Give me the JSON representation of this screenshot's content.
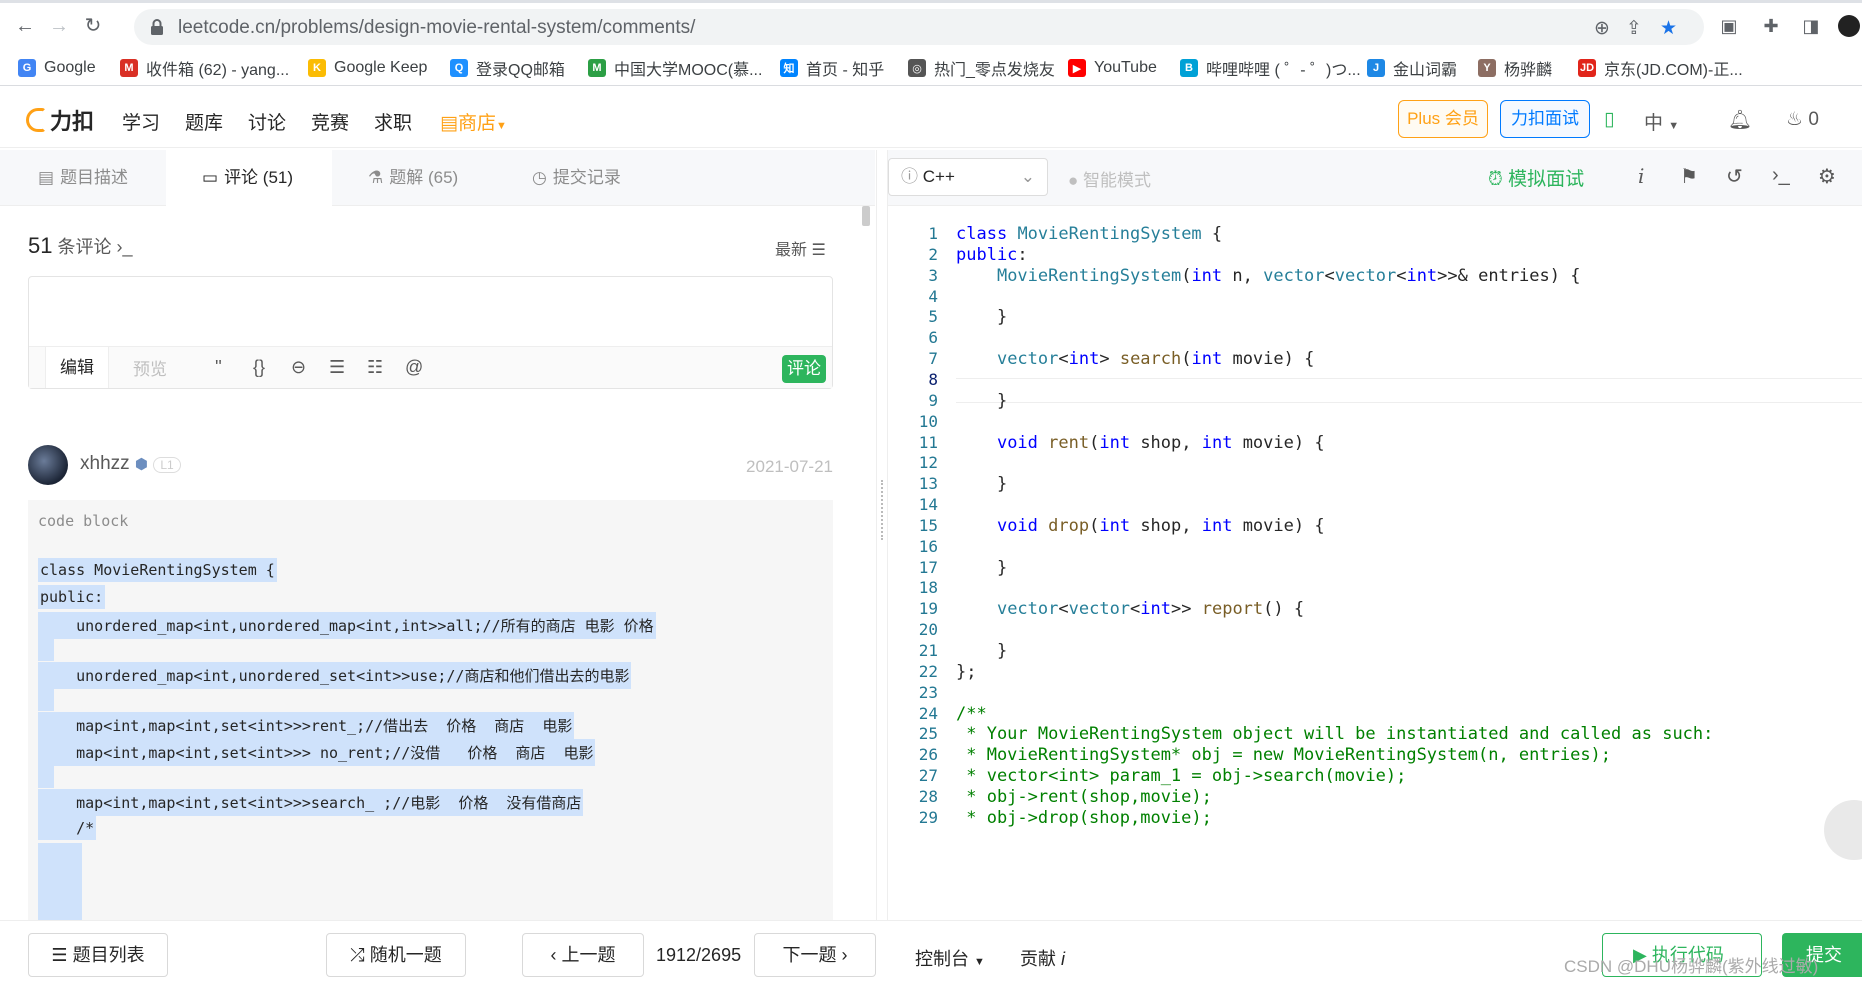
{
  "browser": {
    "url_host": "leetcode.cn",
    "url_path": "/problems/design-movie-rental-system/comments/",
    "bookmarks": [
      {
        "label": "Google",
        "color": "#4285f4",
        "icon": "G"
      },
      {
        "label": "收件箱 (62) - yang...",
        "color": "#d93025",
        "icon": "M"
      },
      {
        "label": "Google Keep",
        "color": "#fbbc04",
        "icon": "K"
      },
      {
        "label": "登录QQ邮箱",
        "color": "#1e90ff",
        "icon": "Q"
      },
      {
        "label": "中国大学MOOC(慕...",
        "color": "#2c9f45",
        "icon": "M"
      },
      {
        "label": "首页 - 知乎",
        "color": "#0084ff",
        "icon": "知"
      },
      {
        "label": "热门_零点发烧友",
        "color": "#555555",
        "icon": "◎"
      },
      {
        "label": "YouTube",
        "color": "#ff0000",
        "icon": "▶"
      },
      {
        "label": "哔哩哔哩 ( ゜- ゜)つ...",
        "color": "#00a1d6",
        "icon": "B"
      },
      {
        "label": "金山词霸",
        "color": "#1e88e5",
        "icon": "J"
      },
      {
        "label": "杨骅麟",
        "color": "#8d6e63",
        "icon": "Y"
      },
      {
        "label": "京东(JD.COM)-正...",
        "color": "#e1251b",
        "icon": "JD"
      }
    ]
  },
  "site": {
    "logo": "力扣",
    "nav": [
      "学习",
      "题库",
      "讨论",
      "竞赛",
      "求职",
      "商店"
    ],
    "plus": "Plus 会员",
    "mock_interview": "力扣面试",
    "lang_switch": "中",
    "points": "0"
  },
  "left": {
    "tabs": [
      "题目描述",
      "评论 (51)",
      "题解 (65)",
      "提交记录"
    ],
    "comment_count": "51",
    "comment_label": "条评论",
    "sort": "最新",
    "editor_tabs": [
      "编辑",
      "预览"
    ],
    "post": "评论",
    "comment": {
      "user": "xhhzz",
      "level": "L1",
      "date": "2021-07-21",
      "code_label": "code block",
      "code_lines": [
        "class MovieRentingSystem {",
        "public:",
        "    unordered_map<int,unordered_map<int,int>>all;//所有的商店 电影 价格",
        "",
        "    unordered_map<int,unordered_set<int>>use;//商店和他们借出去的电影",
        "",
        "    map<int,map<int,set<int>>>rent_;//借出去  价格  商店  电影",
        "    map<int,map<int,set<int>>> no_rent;//没借   价格  商店  电影",
        "",
        "    map<int,map<int,set<int>>>search_ ;//电影  价格  没有借商店",
        "    /*"
      ]
    }
  },
  "right": {
    "language": "C++",
    "smart_mode": "智能模式",
    "mock": "模拟面试",
    "code_lines": [
      "class MovieRentingSystem {",
      "public:",
      "    MovieRentingSystem(int n, vector<vector<int>>& entries) {",
      "",
      "    }",
      "",
      "    vector<int> search(int movie) {",
      "",
      "    }",
      "",
      "    void rent(int shop, int movie) {",
      "",
      "    }",
      "",
      "    void drop(int shop, int movie) {",
      "",
      "    }",
      "",
      "    vector<vector<int>> report() {",
      "",
      "    }",
      "};",
      "",
      "/**",
      " * Your MovieRentingSystem object will be instantiated and called as such:",
      " * MovieRentingSystem* obj = new MovieRentingSystem(n, entries);",
      " * vector<int> param_1 = obj->search(movie);",
      " * obj->rent(shop,movie);",
      " * obj->drop(shop,movie);"
    ]
  },
  "bottom": {
    "problem_list": "题目列表",
    "random": "随机一题",
    "prev": "上一题",
    "progress": "1912/2695",
    "next": "下一题",
    "console": "控制台",
    "contribute": "贡献",
    "run": "执行代码",
    "submit": "提交",
    "watermark": "CSDN @DHU杨骅麟(紫外线过敏)"
  },
  "colors": {
    "accent": "#ffa116",
    "green": "#2db55d",
    "blue": "#007aff"
  }
}
